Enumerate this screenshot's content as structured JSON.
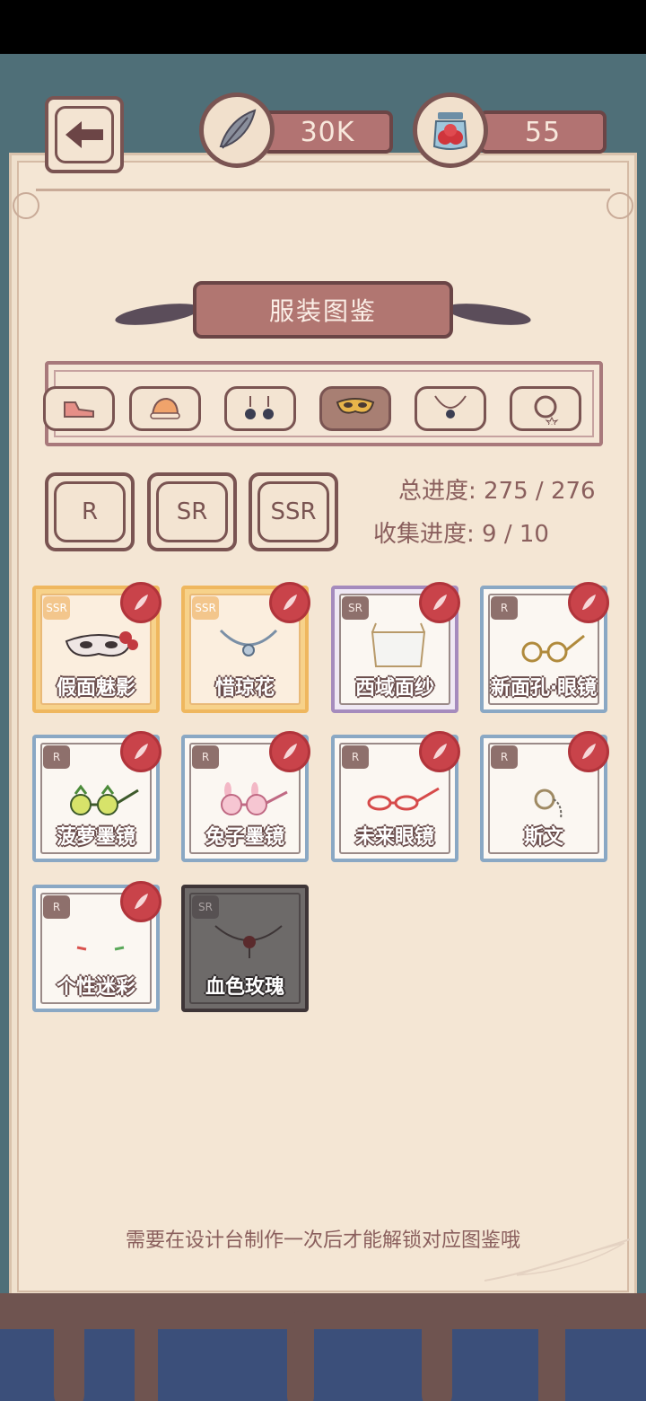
{
  "header": {
    "currencies": [
      {
        "icon": "feather-icon",
        "value": "30K"
      },
      {
        "icon": "berry-jar-icon",
        "value": "55"
      }
    ]
  },
  "title": "服装图鉴",
  "categories": [
    {
      "icon": "shoes-icon",
      "active": false
    },
    {
      "icon": "hat-icon",
      "active": false
    },
    {
      "icon": "earrings-icon",
      "active": false
    },
    {
      "icon": "mask-icon",
      "active": true
    },
    {
      "icon": "necklace-icon",
      "active": false
    },
    {
      "icon": "bracelet-icon",
      "active": false
    }
  ],
  "rarity_filters": [
    "R",
    "SR",
    "SSR"
  ],
  "progress": {
    "total_label": "总进度:",
    "total_value": "275 / 276",
    "collect_label": "收集进度:",
    "collect_value": "9 / 10"
  },
  "items": [
    {
      "name": "假面魅影",
      "rank": "SSR",
      "style": "ssr",
      "art": "mask-icon"
    },
    {
      "name": "惜琼花",
      "rank": "SSR",
      "style": "ssr",
      "art": "necklace-icon"
    },
    {
      "name": "西域面纱",
      "rank": "SR",
      "style": "sr",
      "art": "veil-icon"
    },
    {
      "name": "新面孔·眼镜",
      "rank": "R",
      "style": "r",
      "art": "glasses-icon"
    },
    {
      "name": "菠萝墨镜",
      "rank": "R",
      "style": "r",
      "art": "pineapple-glasses-icon"
    },
    {
      "name": "兔子墨镜",
      "rank": "R",
      "style": "r",
      "art": "bunny-glasses-icon"
    },
    {
      "name": "未来眼镜",
      "rank": "R",
      "style": "r",
      "art": "red-glasses-icon"
    },
    {
      "name": "斯文",
      "rank": "R",
      "style": "r",
      "art": "monocle-icon"
    },
    {
      "name": "个性迷彩",
      "rank": "R",
      "style": "r",
      "art": "face-paint-icon"
    },
    {
      "name": "血色玫瑰",
      "rank": "SR",
      "style": "locked",
      "art": "rose-choker-icon"
    }
  ],
  "hint": "需要在设计台制作一次后才能解锁对应图鉴哦",
  "colors": {
    "paper": "#f4e6d4",
    "accent": "#b17671",
    "seal": "#c9434a"
  }
}
